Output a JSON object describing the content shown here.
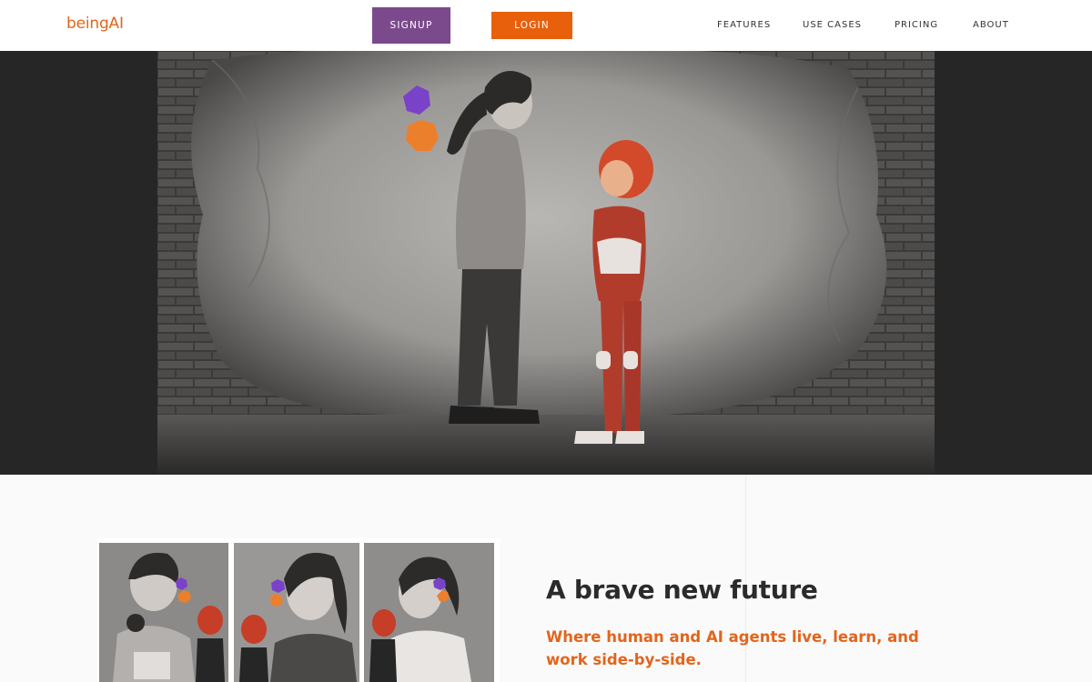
{
  "brand": {
    "logo_text": "beingAI",
    "accent": "#e2651c",
    "purple": "#7b4a8c"
  },
  "header": {
    "signup_label": "SIGNUP",
    "login_label": "LOGIN",
    "nav": {
      "features": "FEATURES",
      "use_cases": "USE CASES",
      "pricing": "PRICING",
      "about": "ABOUT"
    }
  },
  "hero": {
    "image": "girl-and-robot-girl-mural-image"
  },
  "intro": {
    "collage": [
      "student-with-robot-image",
      "woman-with-robot-image",
      "doctor-with-robot-image"
    ],
    "headline": "A brave new future",
    "subheadline": "Where human and AI agents live, learn, and work side-by-side."
  }
}
